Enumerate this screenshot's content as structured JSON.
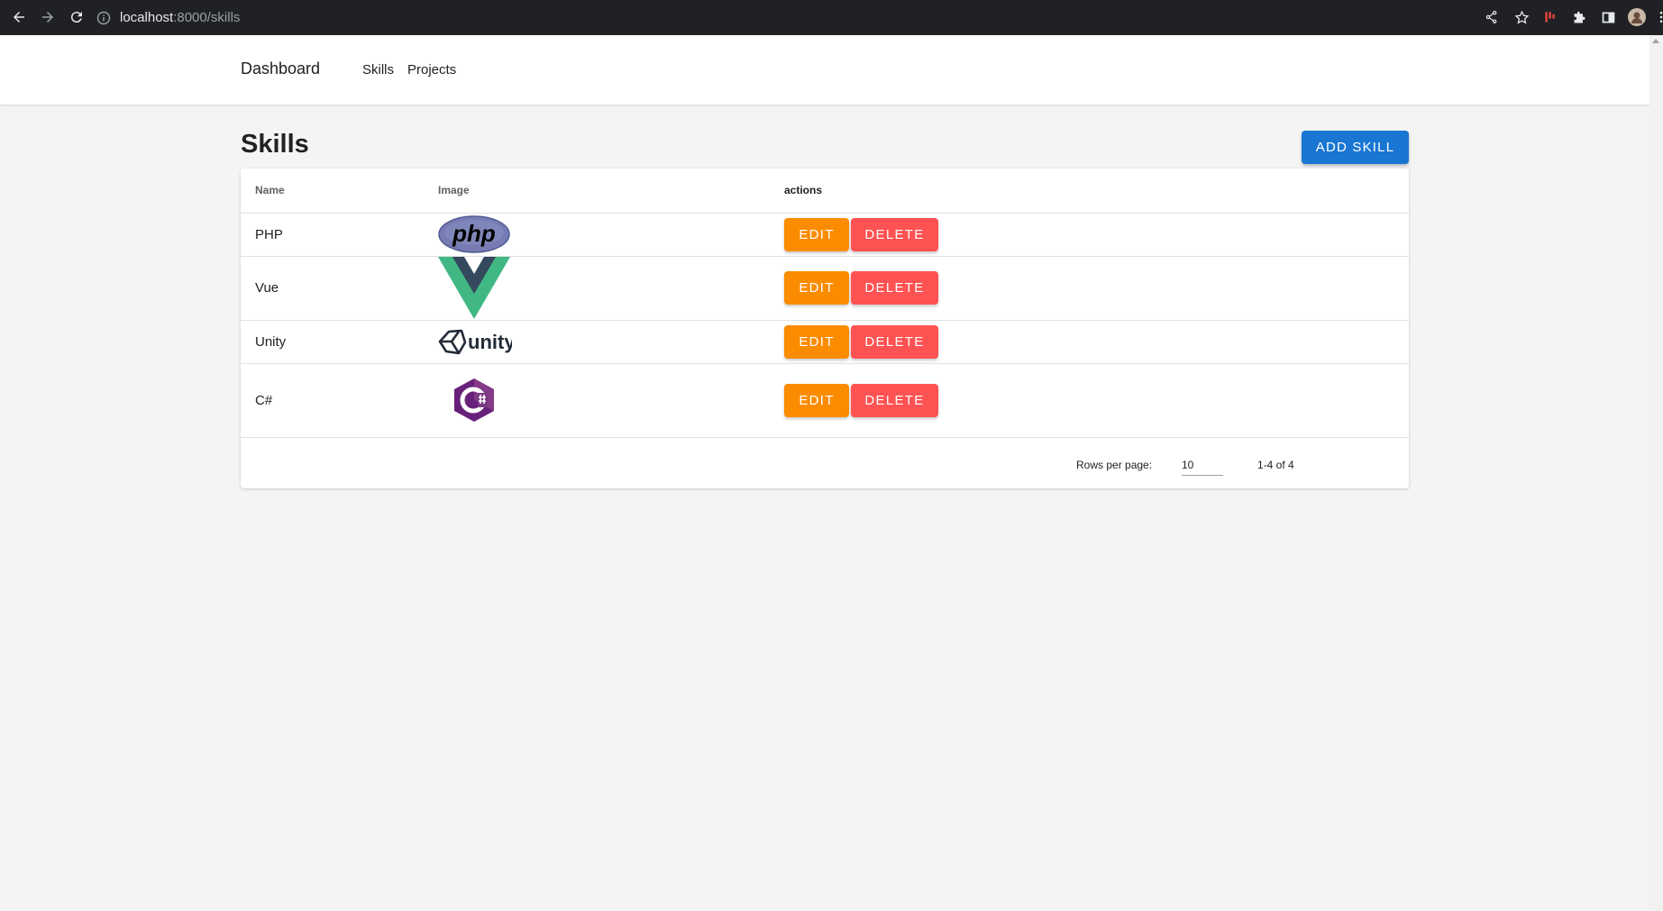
{
  "browser": {
    "url_host": "localhost",
    "url_rest": ":8000/skills"
  },
  "nav": {
    "brand": "Dashboard",
    "links": [
      "Skills",
      "Projects"
    ]
  },
  "page": {
    "title": "Skills",
    "add_label": "ADD SKILL"
  },
  "table": {
    "headers": {
      "name": "Name",
      "image": "Image",
      "actions": "actions"
    },
    "rows": [
      {
        "name": "PHP",
        "logo": "php-logo"
      },
      {
        "name": "Vue",
        "logo": "vue-logo"
      },
      {
        "name": "Unity",
        "logo": "unity-logo"
      },
      {
        "name": "C#",
        "logo": "csharp-logo"
      }
    ],
    "edit_label": "EDIT",
    "delete_label": "DELETE"
  },
  "pagination": {
    "rows_per_page_label": "Rows per page:",
    "rows_per_page": "10",
    "range": "1-4 of 4"
  },
  "logos": {
    "php_text": "php",
    "unity_text": "unity"
  },
  "colors": {
    "primary": "#1976d2",
    "edit": "#fb8c00",
    "delete": "#ff5252"
  }
}
